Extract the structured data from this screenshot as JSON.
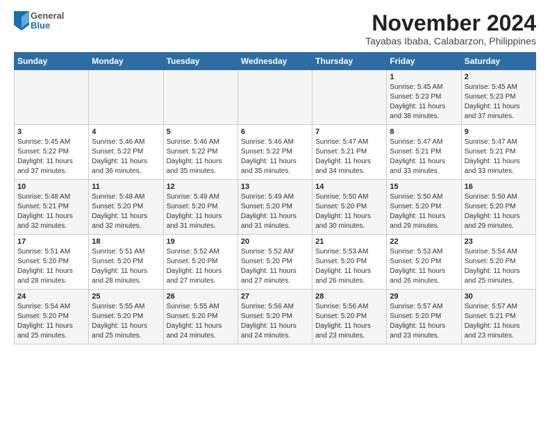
{
  "logo": {
    "general": "General",
    "blue": "Blue"
  },
  "title": "November 2024",
  "subtitle": "Tayabas Ibaba, Calabarzon, Philippines",
  "days_of_week": [
    "Sunday",
    "Monday",
    "Tuesday",
    "Wednesday",
    "Thursday",
    "Friday",
    "Saturday"
  ],
  "weeks": [
    [
      {
        "day": "",
        "info": ""
      },
      {
        "day": "",
        "info": ""
      },
      {
        "day": "",
        "info": ""
      },
      {
        "day": "",
        "info": ""
      },
      {
        "day": "",
        "info": ""
      },
      {
        "day": "1",
        "info": "Sunrise: 5:45 AM\nSunset: 5:23 PM\nDaylight: 11 hours and 38 minutes."
      },
      {
        "day": "2",
        "info": "Sunrise: 5:45 AM\nSunset: 5:23 PM\nDaylight: 11 hours and 37 minutes."
      }
    ],
    [
      {
        "day": "3",
        "info": "Sunrise: 5:45 AM\nSunset: 5:22 PM\nDaylight: 11 hours and 37 minutes."
      },
      {
        "day": "4",
        "info": "Sunrise: 5:46 AM\nSunset: 5:22 PM\nDaylight: 11 hours and 36 minutes."
      },
      {
        "day": "5",
        "info": "Sunrise: 5:46 AM\nSunset: 5:22 PM\nDaylight: 11 hours and 35 minutes."
      },
      {
        "day": "6",
        "info": "Sunrise: 5:46 AM\nSunset: 5:22 PM\nDaylight: 11 hours and 35 minutes."
      },
      {
        "day": "7",
        "info": "Sunrise: 5:47 AM\nSunset: 5:21 PM\nDaylight: 11 hours and 34 minutes."
      },
      {
        "day": "8",
        "info": "Sunrise: 5:47 AM\nSunset: 5:21 PM\nDaylight: 11 hours and 33 minutes."
      },
      {
        "day": "9",
        "info": "Sunrise: 5:47 AM\nSunset: 5:21 PM\nDaylight: 11 hours and 33 minutes."
      }
    ],
    [
      {
        "day": "10",
        "info": "Sunrise: 5:48 AM\nSunset: 5:21 PM\nDaylight: 11 hours and 32 minutes."
      },
      {
        "day": "11",
        "info": "Sunrise: 5:48 AM\nSunset: 5:20 PM\nDaylight: 11 hours and 32 minutes."
      },
      {
        "day": "12",
        "info": "Sunrise: 5:49 AM\nSunset: 5:20 PM\nDaylight: 11 hours and 31 minutes."
      },
      {
        "day": "13",
        "info": "Sunrise: 5:49 AM\nSunset: 5:20 PM\nDaylight: 11 hours and 31 minutes."
      },
      {
        "day": "14",
        "info": "Sunrise: 5:50 AM\nSunset: 5:20 PM\nDaylight: 11 hours and 30 minutes."
      },
      {
        "day": "15",
        "info": "Sunrise: 5:50 AM\nSunset: 5:20 PM\nDaylight: 11 hours and 29 minutes."
      },
      {
        "day": "16",
        "info": "Sunrise: 5:50 AM\nSunset: 5:20 PM\nDaylight: 11 hours and 29 minutes."
      }
    ],
    [
      {
        "day": "17",
        "info": "Sunrise: 5:51 AM\nSunset: 5:20 PM\nDaylight: 11 hours and 28 minutes."
      },
      {
        "day": "18",
        "info": "Sunrise: 5:51 AM\nSunset: 5:20 PM\nDaylight: 11 hours and 28 minutes."
      },
      {
        "day": "19",
        "info": "Sunrise: 5:52 AM\nSunset: 5:20 PM\nDaylight: 11 hours and 27 minutes."
      },
      {
        "day": "20",
        "info": "Sunrise: 5:52 AM\nSunset: 5:20 PM\nDaylight: 11 hours and 27 minutes."
      },
      {
        "day": "21",
        "info": "Sunrise: 5:53 AM\nSunset: 5:20 PM\nDaylight: 11 hours and 26 minutes."
      },
      {
        "day": "22",
        "info": "Sunrise: 5:53 AM\nSunset: 5:20 PM\nDaylight: 11 hours and 26 minutes."
      },
      {
        "day": "23",
        "info": "Sunrise: 5:54 AM\nSunset: 5:20 PM\nDaylight: 11 hours and 25 minutes."
      }
    ],
    [
      {
        "day": "24",
        "info": "Sunrise: 5:54 AM\nSunset: 5:20 PM\nDaylight: 11 hours and 25 minutes."
      },
      {
        "day": "25",
        "info": "Sunrise: 5:55 AM\nSunset: 5:20 PM\nDaylight: 11 hours and 25 minutes."
      },
      {
        "day": "26",
        "info": "Sunrise: 5:55 AM\nSunset: 5:20 PM\nDaylight: 11 hours and 24 minutes."
      },
      {
        "day": "27",
        "info": "Sunrise: 5:56 AM\nSunset: 5:20 PM\nDaylight: 11 hours and 24 minutes."
      },
      {
        "day": "28",
        "info": "Sunrise: 5:56 AM\nSunset: 5:20 PM\nDaylight: 11 hours and 23 minutes."
      },
      {
        "day": "29",
        "info": "Sunrise: 5:57 AM\nSunset: 5:20 PM\nDaylight: 11 hours and 23 minutes."
      },
      {
        "day": "30",
        "info": "Sunrise: 5:57 AM\nSunset: 5:21 PM\nDaylight: 11 hours and 23 minutes."
      }
    ]
  ]
}
